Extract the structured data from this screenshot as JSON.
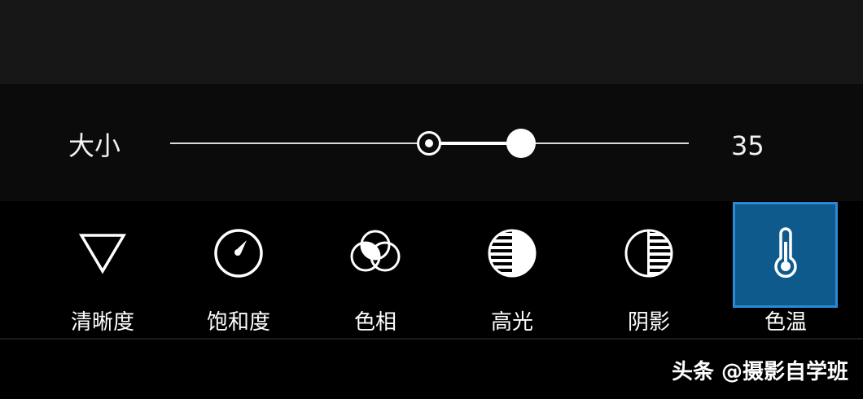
{
  "slider": {
    "label": "大小",
    "value": "35"
  },
  "tools": [
    {
      "label": "清晰度",
      "icon": "triangle-down-icon"
    },
    {
      "label": "饱和度",
      "icon": "gauge-icon"
    },
    {
      "label": "色相",
      "icon": "color-circles-icon"
    },
    {
      "label": "高光",
      "icon": "highlight-sphere-icon"
    },
    {
      "label": "阴影",
      "icon": "shadow-sphere-icon"
    },
    {
      "label": "色温",
      "icon": "thermometer-icon",
      "selected": true
    }
  ],
  "watermark": "头条 @摄影自学班",
  "colors": {
    "selected_background": "#0e5a8c",
    "selected_border": "#2a8ad6"
  }
}
